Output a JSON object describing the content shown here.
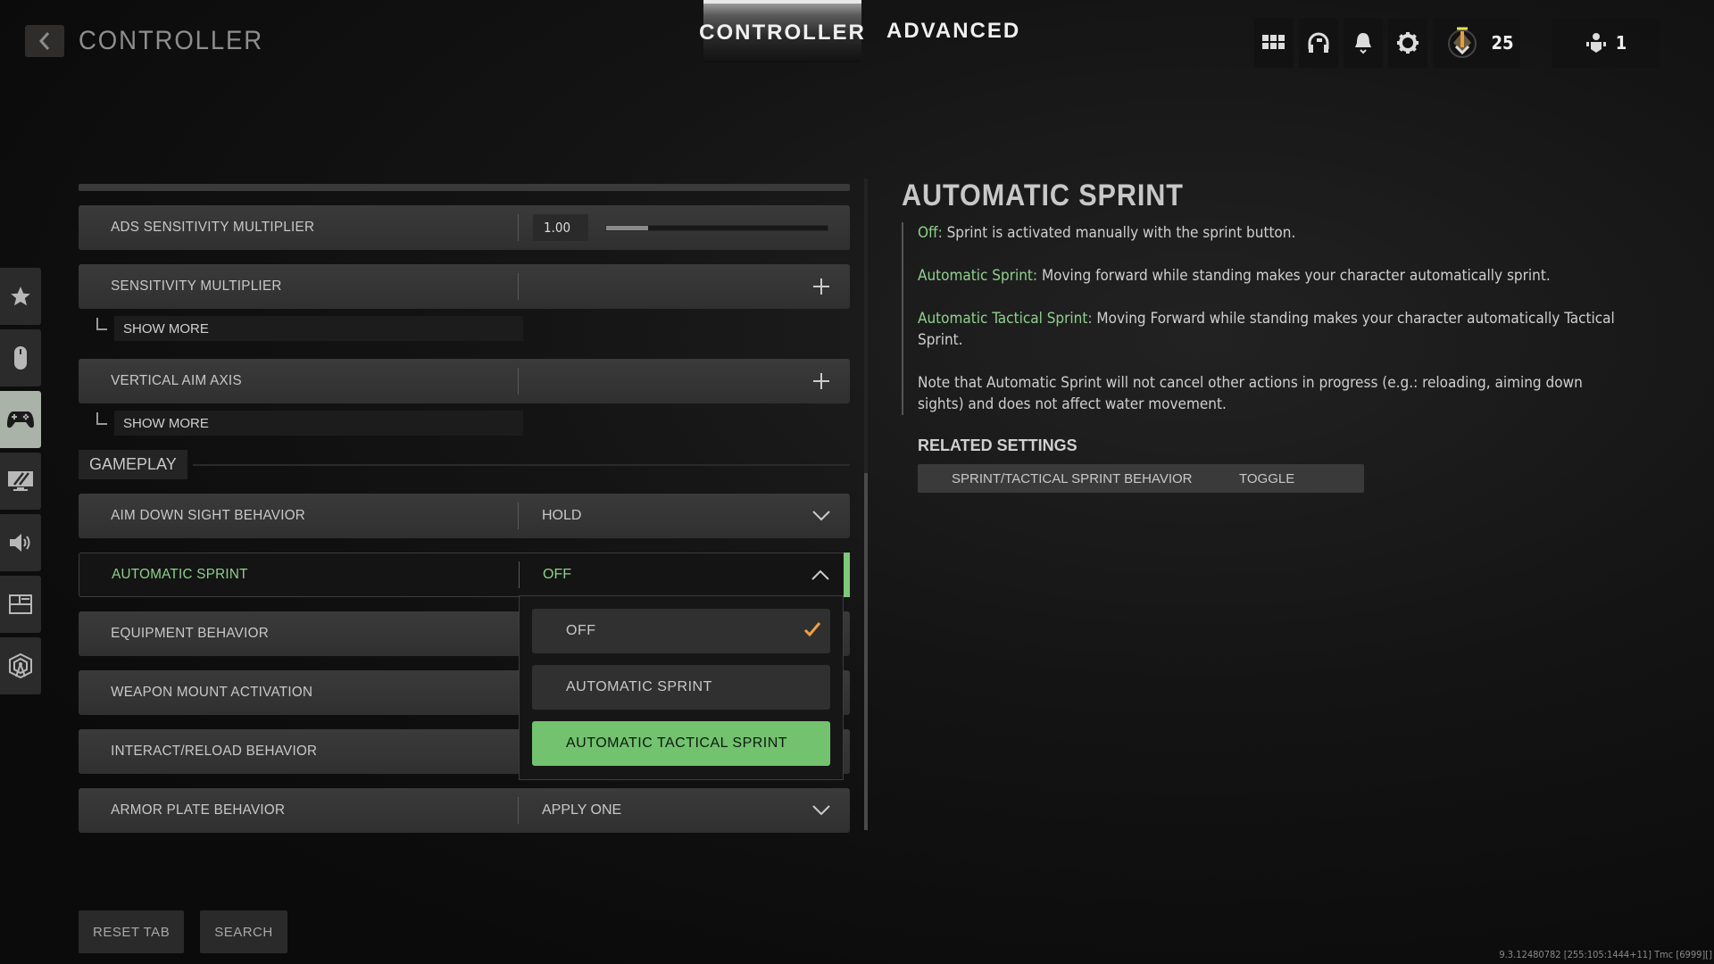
{
  "header": {
    "title": "CONTROLLER",
    "tabs": [
      {
        "label": "CONTROLLER",
        "active": true
      },
      {
        "label": "ADVANCED",
        "active": false
      }
    ],
    "icons": [
      "grid-menu-icon",
      "headset-icon",
      "bell-icon",
      "gear-icon"
    ],
    "rank_level": "25",
    "party_count": "1"
  },
  "sidebar": {
    "items": [
      {
        "icon": "star-icon",
        "active": false
      },
      {
        "icon": "mouse-icon",
        "active": false
      },
      {
        "icon": "gamepad-icon",
        "active": true
      },
      {
        "icon": "display-icon",
        "active": false
      },
      {
        "icon": "speaker-icon",
        "active": false
      },
      {
        "icon": "interface-icon",
        "active": false
      },
      {
        "icon": "network-icon",
        "active": false
      }
    ]
  },
  "settings": {
    "ads_sensitivity": {
      "label": "ADS SENSITIVITY MULTIPLIER",
      "value": "1.00",
      "slider_fraction": 0.19
    },
    "sensitivity_multiplier": {
      "label": "SENSITIVITY MULTIPLIER"
    },
    "show_more_label": "SHOW MORE",
    "vertical_aim_axis": {
      "label": "VERTICAL AIM AXIS"
    },
    "section_gameplay": "GAMEPLAY",
    "aim_down_sight": {
      "label": "AIM DOWN SIGHT BEHAVIOR",
      "value": "HOLD"
    },
    "automatic_sprint": {
      "label": "AUTOMATIC SPRINT",
      "value": "OFF"
    },
    "equipment_behavior": {
      "label": "EQUIPMENT BEHAVIOR"
    },
    "weapon_mount": {
      "label": "WEAPON MOUNT ACTIVATION"
    },
    "interact_reload": {
      "label": "INTERACT/RELOAD BEHAVIOR"
    },
    "armor_plate": {
      "label": "ARMOR PLATE BEHAVIOR",
      "value": "APPLY ONE"
    }
  },
  "dropdown": {
    "options": [
      {
        "label": "OFF",
        "selected": true,
        "highlighted": false
      },
      {
        "label": "AUTOMATIC SPRINT",
        "selected": false,
        "highlighted": false
      },
      {
        "label": "AUTOMATIC TACTICAL SPRINT",
        "selected": false,
        "highlighted": true
      }
    ]
  },
  "detail": {
    "title": "AUTOMATIC SPRINT",
    "entries": [
      {
        "key": "Off:",
        "text": " Sprint is activated manually with the sprint button."
      },
      {
        "key": "Automatic Sprint:",
        "text": " Moving forward while standing makes your character automatically sprint."
      },
      {
        "key": "Automatic Tactical Sprint:",
        "text": " Moving Forward while standing makes your character automatically Tactical Sprint."
      }
    ],
    "note": "Note that Automatic Sprint will not cancel other actions in progress (e.g.: reloading, aiming down sights) and does not affect water movement.",
    "related_title": "RELATED SETTINGS",
    "related": [
      {
        "label": "SPRINT/TACTICAL SPRINT BEHAVIOR",
        "value": "TOGGLE"
      }
    ]
  },
  "footer": {
    "reset_tab": "RESET TAB",
    "search": "SEARCH",
    "version": "9.3.12480782 [255:105:1444+11] Tmc [6999][]"
  },
  "colors": {
    "accent_green": "#7ec87a",
    "check_orange": "#f0a040"
  }
}
